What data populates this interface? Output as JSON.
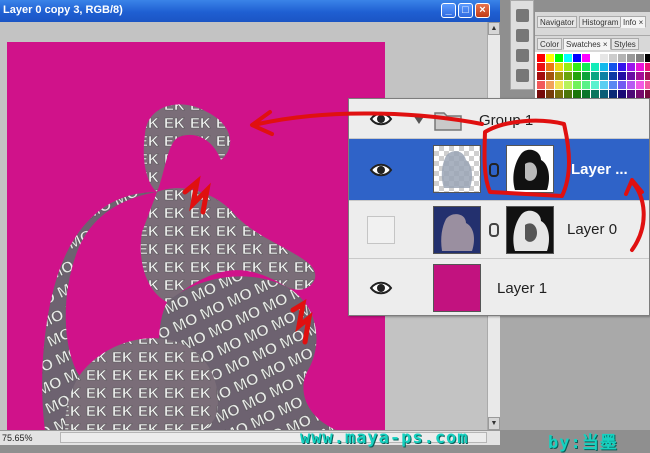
{
  "document": {
    "title": "Layer 0 copy 3, RGB/8)",
    "status_zoom": "75.65%",
    "canvas_color": "#d0128a",
    "buttons": {
      "minimize": "_",
      "maximize": "□",
      "close": "×"
    }
  },
  "panel_tabs_top": [
    "Navigator",
    "Histogram",
    "Info ×"
  ],
  "panel_tabs_mid": [
    "Color",
    "Swatches ×",
    "Styles"
  ],
  "layers": [
    {
      "name": "Group 1",
      "visible": true,
      "type": "group"
    },
    {
      "name": "Layer ...",
      "visible": true,
      "type": "layer-with-mask",
      "selected": true
    },
    {
      "name": "Layer 0",
      "visible": false,
      "type": "layer-with-mask"
    },
    {
      "name": "Layer 1",
      "visible": true,
      "type": "fill",
      "color": "#c2127f"
    }
  ],
  "watermark": {
    "url": "www.maya-ps.com",
    "author": "by:当墨"
  },
  "colors": {
    "selection": "#2f63c8",
    "annotation_red": "#e01010",
    "titlebar_blue": "#1f5fd2"
  },
  "icons": [
    "eye-icon",
    "folder-icon",
    "triangle-icon",
    "chain-link-icon",
    "move-tool-icon",
    "brush-tool-icon"
  ]
}
